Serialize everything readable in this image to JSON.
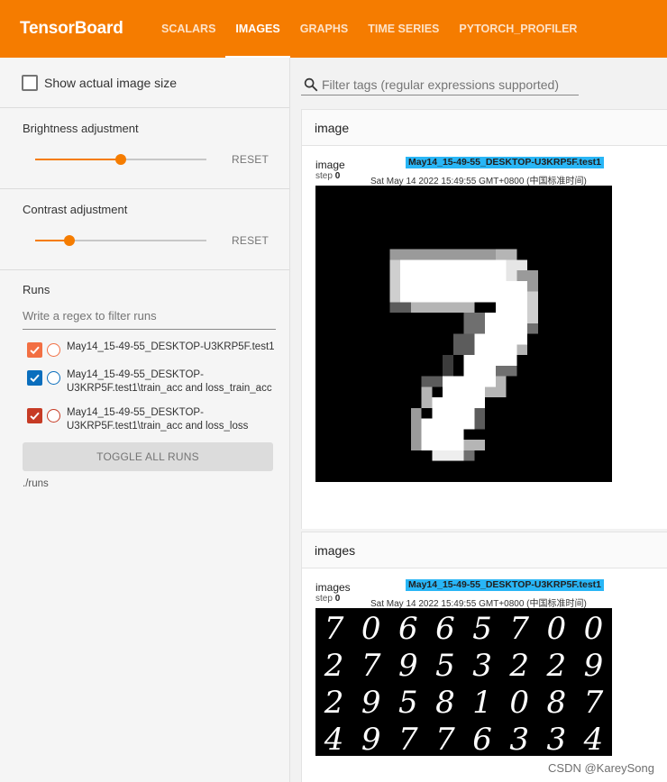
{
  "app": {
    "title": "TensorBoard",
    "tabs": [
      {
        "label": "SCALARS",
        "active": false
      },
      {
        "label": "IMAGES",
        "active": true
      },
      {
        "label": "GRAPHS",
        "active": false
      },
      {
        "label": "TIME SERIES",
        "active": false
      },
      {
        "label": "PYTORCH_PROFILER",
        "active": false
      }
    ],
    "accent_color": "#f57c00"
  },
  "sidebar": {
    "show_actual_size": {
      "label": "Show actual image size",
      "checked": false
    },
    "brightness": {
      "title": "Brightness adjustment",
      "value": 0.5,
      "reset_label": "RESET"
    },
    "contrast": {
      "title": "Contrast adjustment",
      "value": 0.2,
      "reset_label": "RESET"
    },
    "runs": {
      "title": "Runs",
      "filter_placeholder": "Write a regex to filter runs",
      "items": [
        {
          "label": "May14_15-49-55_DESKTOP-U3KRP5F.test1",
          "color": "#f26f43",
          "checked": true
        },
        {
          "label": "May14_15-49-55_DESKTOP-U3KRP5F.test1\\train_acc and loss_train_acc",
          "color": "#0a6ebd",
          "checked": true
        },
        {
          "label": "May14_15-49-55_DESKTOP-U3KRP5F.test1\\train_acc and loss_loss",
          "color": "#c63b25",
          "checked": true
        }
      ],
      "toggle_label": "TOGGLE ALL RUNS",
      "log_dir": "./runs"
    }
  },
  "main": {
    "filter_placeholder": "Filter tags (regular expressions supported)",
    "cards": [
      {
        "header": "image",
        "tag": "image",
        "step_label": "step",
        "step": "0",
        "run": "May14_15-49-55_DESKTOP-U3KRP5F.test1",
        "timestamp": "Sat May 14 2022 15:49:55 GMT+0800 (中国标准时间)"
      },
      {
        "header": "images",
        "tag": "images",
        "step_label": "step",
        "step": "0",
        "run": "May14_15-49-55_DESKTOP-U3KRP5F.test1",
        "timestamp": "Sat May 14 2022 15:49:55 GMT+0800 (中国标准时间)",
        "digits": [
          "7",
          "0",
          "6",
          "6",
          "5",
          "7",
          "0",
          "0",
          "2",
          "7",
          "9",
          "5",
          "3",
          "2",
          "2",
          "9",
          "2",
          "9",
          "5",
          "8",
          "1",
          "0",
          "8",
          "7",
          "4",
          "9",
          "7",
          "7",
          "6",
          "3",
          "3",
          "4"
        ]
      }
    ]
  },
  "watermark": "CSDN @KareySong"
}
